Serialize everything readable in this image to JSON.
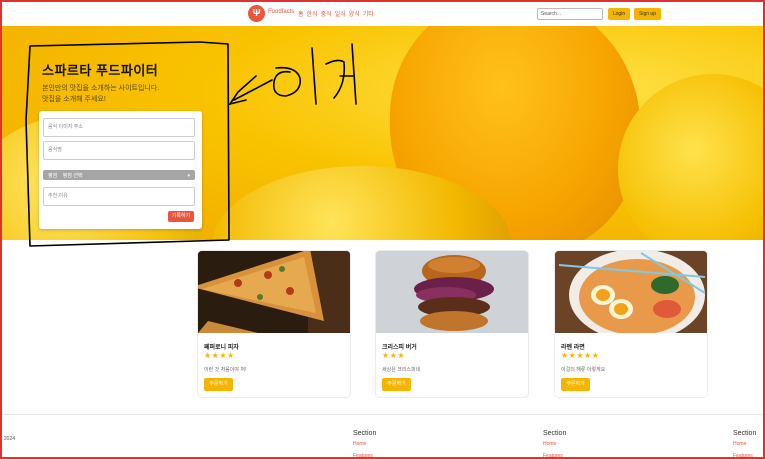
{
  "nav": {
    "brand": "Foodfacts",
    "links": [
      "홈",
      "한식",
      "중식",
      "일식",
      "양식",
      "기타"
    ],
    "search_value": "Search...",
    "login": "Login",
    "signup": "Sign up"
  },
  "hero": {
    "title": "스파르타 푸드파이터",
    "subtitle_line1": "본인만의 맛집을 소개하는 사이트입니다.",
    "subtitle_line2": "맛집을 소개해 주세요!",
    "form": {
      "url_placeholder": "음식 이미지 주소",
      "name_placeholder": "음식명",
      "select_label": "평점",
      "select_value": "평점 선택",
      "reason_placeholder": "추천 이유",
      "submit": "기록하기"
    },
    "annotation": "<-이거"
  },
  "cards": [
    {
      "title": "페퍼로니 피자",
      "stars": "★★★★",
      "desc": "이런 것 처음이야 처!",
      "button": "주문하기"
    },
    {
      "title": "크리스피 버거",
      "stars": "★★★",
      "desc": "세상은 크리스피네",
      "button": "주문하기"
    },
    {
      "title": "라멘 라면",
      "stars": "★★★★★",
      "desc": "이걸의 해류 이렇게요",
      "button": "주문하기"
    }
  ],
  "footer": {
    "copyright": "s 2024",
    "cols": [
      {
        "heading": "Section",
        "link1": "Home",
        "link2": "Features"
      },
      {
        "heading": "Section",
        "link1": "Home",
        "link2": "Features"
      },
      {
        "heading": "Section",
        "link1": "Home",
        "link2": "Features"
      }
    ]
  },
  "colors": {
    "accent": "#e8563c",
    "button": "#f5b400",
    "scribble": "#000000",
    "frame": "#e03030"
  }
}
